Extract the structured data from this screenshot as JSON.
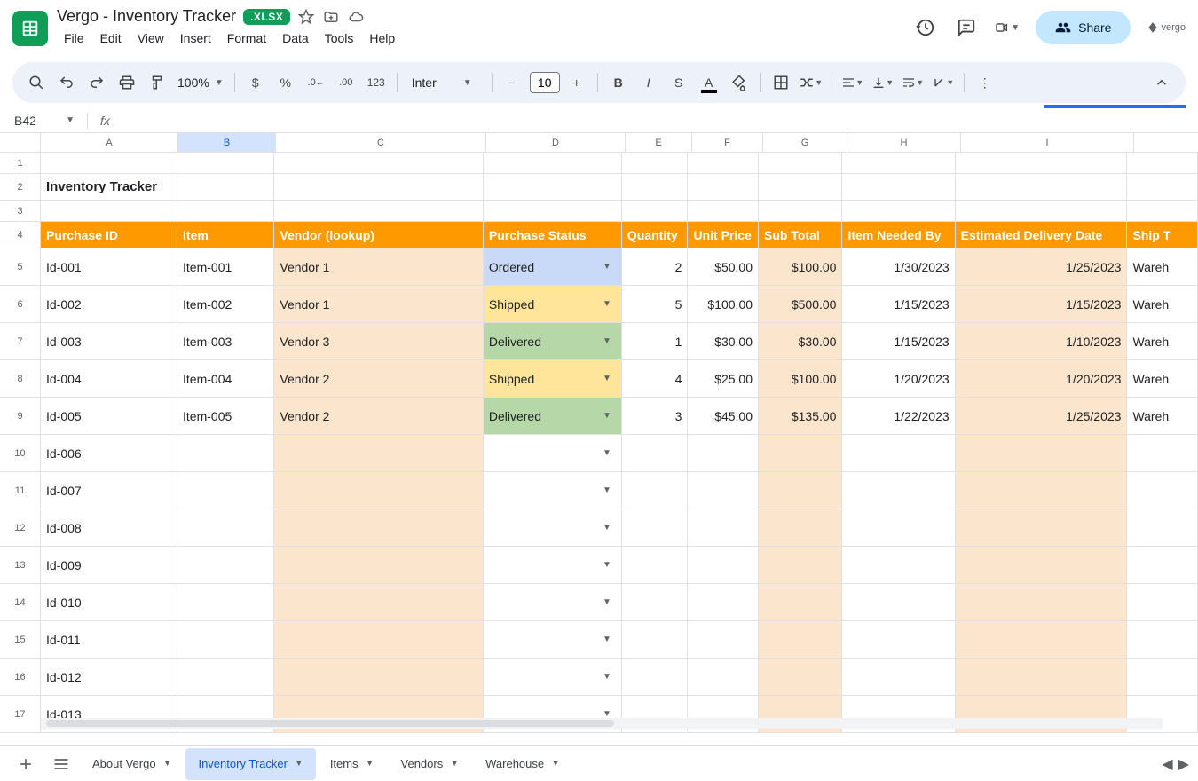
{
  "doc": {
    "title": "Vergo - Inventory Tracker",
    "badge": ".XLSX"
  },
  "menus": [
    "File",
    "Edit",
    "View",
    "Insert",
    "Format",
    "Data",
    "Tools",
    "Help"
  ],
  "toolbar": {
    "zoom": "100%",
    "font": "Inter",
    "size": "10"
  },
  "share": "Share",
  "brand": "vergo",
  "namebox": "B42",
  "columns": [
    "A",
    "B",
    "C",
    "D",
    "E",
    "F",
    "G",
    "H",
    "I"
  ],
  "sheet": {
    "title": "Inventory Tracker",
    "headers": [
      "Purchase ID",
      "Item",
      "Vendor (lookup)",
      "Purchase Status",
      "Quantity",
      "Unit Price",
      "Sub Total",
      "Item Needed By",
      "Estimated Delivery Date",
      "Ship T"
    ],
    "rows": [
      {
        "id": "Id-001",
        "item": "Item-001",
        "vendor": "Vendor 1",
        "status": "Ordered",
        "qty": "2",
        "price": "$50.00",
        "sub": "$100.00",
        "needed": "1/30/2023",
        "est": "1/25/2023",
        "ship": "Wareh"
      },
      {
        "id": "Id-002",
        "item": "Item-002",
        "vendor": "Vendor 1",
        "status": "Shipped",
        "qty": "5",
        "price": "$100.00",
        "sub": "$500.00",
        "needed": "1/15/2023",
        "est": "1/15/2023",
        "ship": "Wareh"
      },
      {
        "id": "Id-003",
        "item": "Item-003",
        "vendor": "Vendor 3",
        "status": "Delivered",
        "qty": "1",
        "price": "$30.00",
        "sub": "$30.00",
        "needed": "1/15/2023",
        "est": "1/10/2023",
        "ship": "Wareh"
      },
      {
        "id": "Id-004",
        "item": "Item-004",
        "vendor": "Vendor 2",
        "status": "Shipped",
        "qty": "4",
        "price": "$25.00",
        "sub": "$100.00",
        "needed": "1/20/2023",
        "est": "1/20/2023",
        "ship": "Wareh"
      },
      {
        "id": "Id-005",
        "item": "Item-005",
        "vendor": "Vendor 2",
        "status": "Delivered",
        "qty": "3",
        "price": "$45.00",
        "sub": "$135.00",
        "needed": "1/22/2023",
        "est": "1/25/2023",
        "ship": "Wareh"
      },
      {
        "id": "Id-006"
      },
      {
        "id": "Id-007"
      },
      {
        "id": "Id-008"
      },
      {
        "id": "Id-009"
      },
      {
        "id": "Id-010"
      },
      {
        "id": "Id-011"
      },
      {
        "id": "Id-012"
      },
      {
        "id": "Id-013"
      }
    ]
  },
  "tabs": [
    "About Vergo",
    "Inventory Tracker",
    "Items",
    "Vendors",
    "Warehouse"
  ],
  "activeTab": 1,
  "statusColors": {
    "Ordered": "status-ordered",
    "Shipped": "status-shipped",
    "Delivered": "status-delivered"
  }
}
